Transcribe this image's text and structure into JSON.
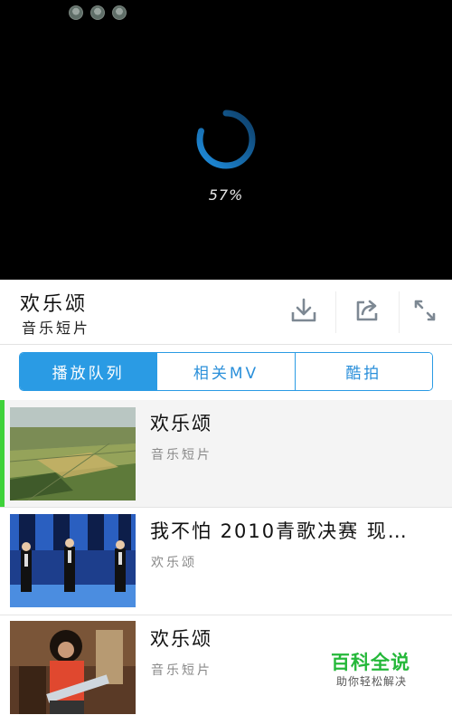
{
  "player": {
    "status_icons": [
      "user-avatar-icon",
      "user-avatar-icon",
      "user-avatar-icon"
    ],
    "loading_progress": 57,
    "progress_text": "57%",
    "accent": "#2a9be4"
  },
  "info": {
    "title": "欢乐颂",
    "subtitle": "音乐短片",
    "actions": [
      "download-icon",
      "share-icon",
      "fullscreen-icon"
    ]
  },
  "tabs": [
    {
      "label": "播放队列",
      "active": true
    },
    {
      "label": "相关MV",
      "active": false
    },
    {
      "label": "酷拍",
      "active": false
    }
  ],
  "playlist": [
    {
      "title": "欢乐颂",
      "subtitle": "音乐短片",
      "active": true,
      "thumb": "farmland-aerial"
    },
    {
      "title": "我不怕 2010青歌决赛 现…",
      "subtitle": "欢乐颂",
      "active": false,
      "thumb": "stage-singers"
    },
    {
      "title": "欢乐颂",
      "subtitle": "音乐短片",
      "active": false,
      "thumb": "performer-red-shirt"
    }
  ],
  "watermark": {
    "title": "百科全说",
    "subtitle": "助你轻松解决"
  },
  "colors": {
    "active_indicator": "#3fd23a",
    "tab_active_bg": "#2a9be4",
    "watermark": "#25b83a"
  }
}
